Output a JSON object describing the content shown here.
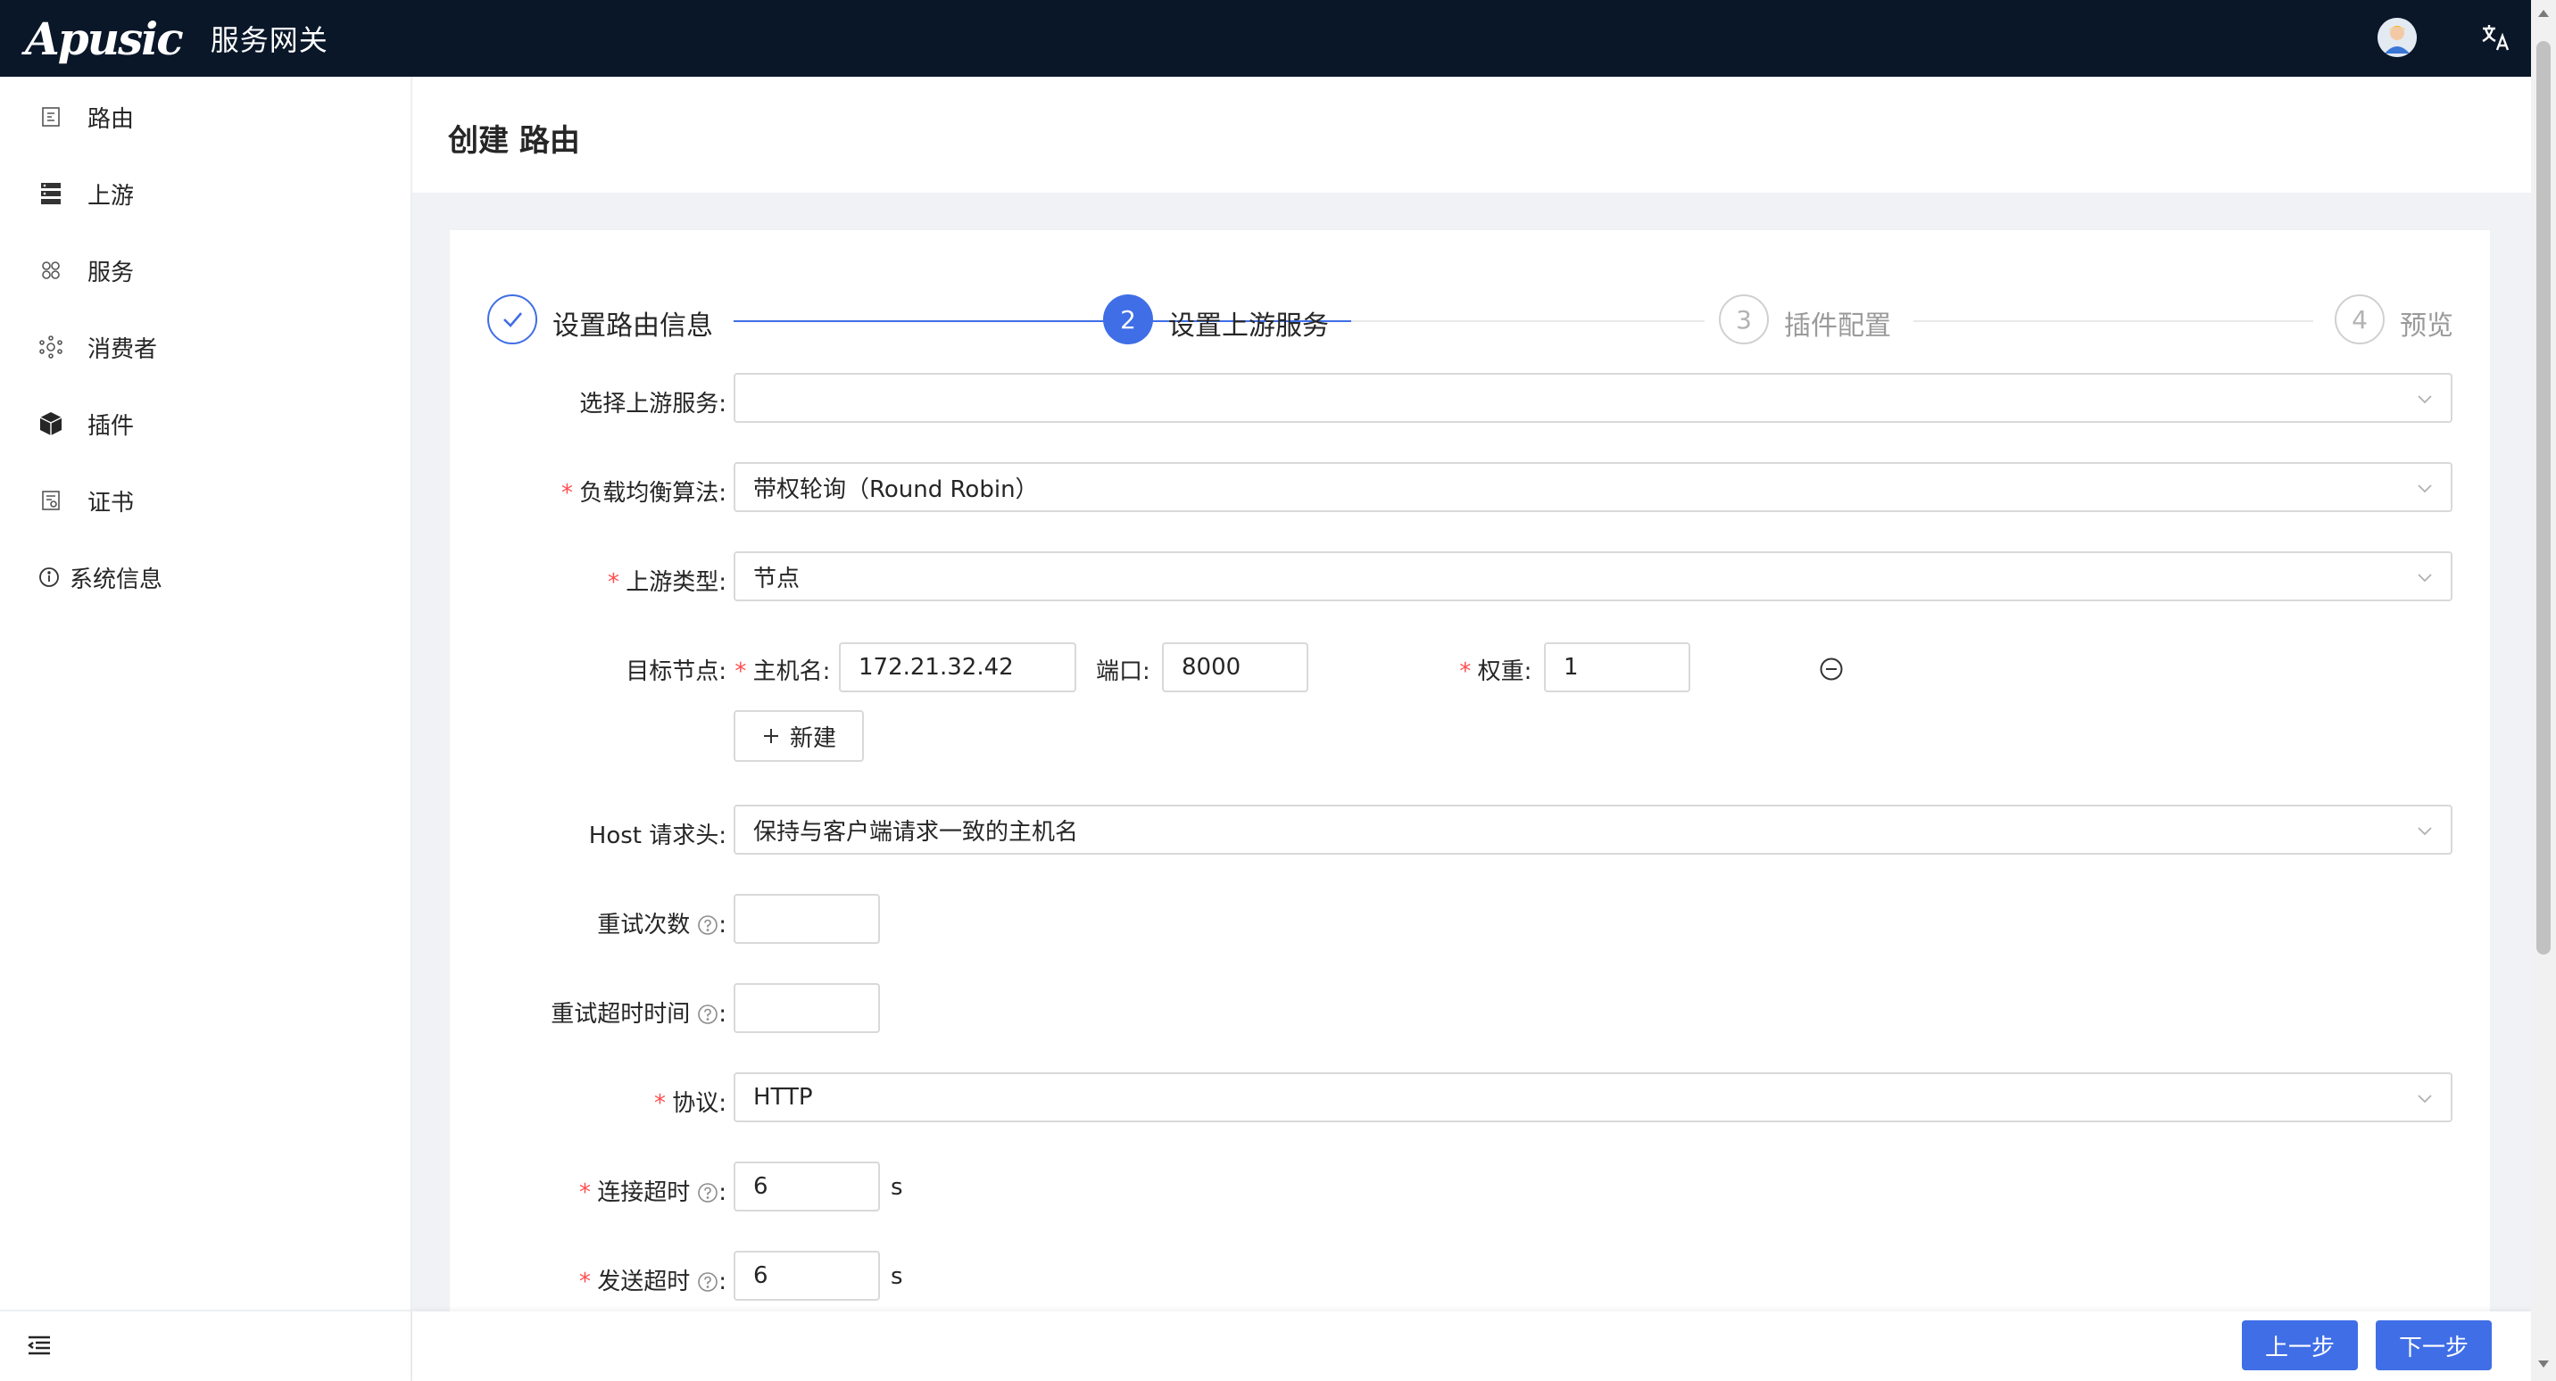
{
  "header": {
    "logo": "Apusic",
    "product": "服务网关",
    "avatar_icon": "user-avatar",
    "language_icon": "translate-icon"
  },
  "sidebar": {
    "items": [
      {
        "label": "路由",
        "icon": "route-icon"
      },
      {
        "label": "上游",
        "icon": "server-icon"
      },
      {
        "label": "服务",
        "icon": "service-icon"
      },
      {
        "label": "消费者",
        "icon": "consumer-icon"
      },
      {
        "label": "插件",
        "icon": "plugin-icon"
      },
      {
        "label": "证书",
        "icon": "certificate-icon"
      },
      {
        "label": "系统信息",
        "icon": "info-icon"
      }
    ],
    "collapse_icon": "menu-fold-icon"
  },
  "page": {
    "title": "创建 路由"
  },
  "steps": [
    {
      "number": "1",
      "title": "设置路由信息",
      "status": "done"
    },
    {
      "number": "2",
      "title": "设置上游服务",
      "status": "active"
    },
    {
      "number": "3",
      "title": "插件配置",
      "status": "todo"
    },
    {
      "number": "4",
      "title": "预览",
      "status": "todo"
    }
  ],
  "form": {
    "upstream_select": {
      "label": "选择上游服务",
      "value": ""
    },
    "lb_algorithm": {
      "label": "负载均衡算法",
      "value": "带权轮询（Round Robin）"
    },
    "upstream_type": {
      "label": "上游类型",
      "value": "节点"
    },
    "target_node": {
      "label": "目标节点",
      "host_label": "主机名",
      "host_value": "172.21.32.42",
      "port_label": "端口",
      "port_value": "8000",
      "weight_label": "权重",
      "weight_value": "1",
      "add_label": "新建"
    },
    "host_header": {
      "label": "Host 请求头",
      "value": "保持与客户端请求一致的主机名"
    },
    "retries": {
      "label": "重试次数",
      "value": ""
    },
    "retry_timeout": {
      "label": "重试超时时间",
      "value": ""
    },
    "protocol": {
      "label": "协议",
      "value": "HTTP"
    },
    "connect_timeout": {
      "label": "连接超时",
      "value": "6",
      "unit": "s"
    },
    "send_timeout": {
      "label": "发送超时",
      "value": "6",
      "unit": "s"
    }
  },
  "footer": {
    "prev_label": "上一步",
    "next_label": "下一步"
  },
  "colors": {
    "primary": "#3f6ee6",
    "header_bg": "#0a1729",
    "required": "#ff4d4f"
  }
}
